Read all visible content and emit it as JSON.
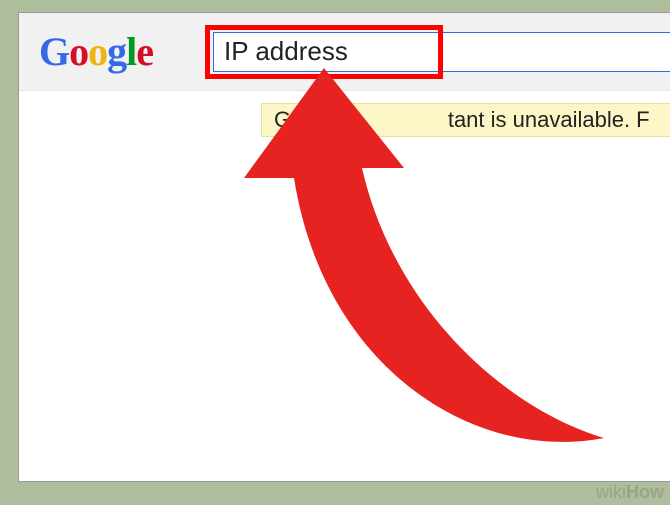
{
  "logo": {
    "g1": "G",
    "o1": "o",
    "o2": "o",
    "g2": "g",
    "l": "l",
    "e": "e"
  },
  "search": {
    "value": "IP address"
  },
  "notice": {
    "text_left": "Goog",
    "text_right": "tant is unavailable. F"
  },
  "watermark": {
    "part1": "wiki",
    "part2": "How"
  }
}
